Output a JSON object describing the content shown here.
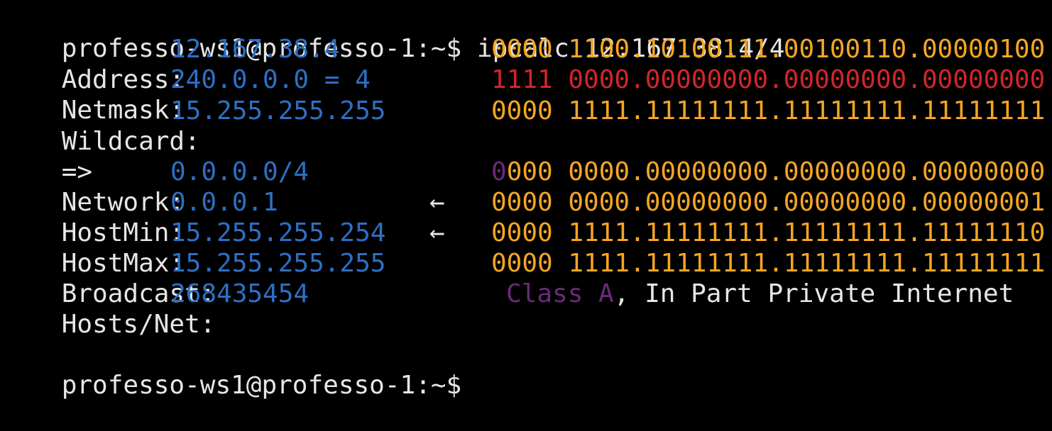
{
  "colors": {
    "background": "#000000",
    "text": "#e6e6e6",
    "value": "#2d6fc4",
    "binary": "#f5a623",
    "netmask_binary": "#d0262a",
    "class_marker": "#6b2a7a"
  },
  "prompt": "professo-ws1@professo-1:~$",
  "command": " ipcalc 12.167.38.4/4",
  "rows": {
    "address": {
      "label": "Address:",
      "value": "12.167.38.4",
      "bin_net": "0000",
      "bin_host": " 1100.10100111.00100110.00000100"
    },
    "netmask": {
      "label": "Netmask:",
      "value": "240.0.0.0 = 4",
      "bin_net": "1111",
      "bin_host": " 0000.00000000.00000000.00000000"
    },
    "wildcard": {
      "label": "Wildcard:",
      "value": "15.255.255.255",
      "bin_net": "0000",
      "bin_host": " 1111.11111111.11111111.11111111"
    },
    "network": {
      "label": "Network:",
      "value": "0.0.0.0/4",
      "bin_class": "0",
      "bin_rest": "000 0000.00000000.00000000.00000000"
    },
    "hostmin": {
      "label": "HostMin:",
      "value": "0.0.0.1",
      "arrow": "←",
      "bin": "0000 0000.00000000.00000000.00000001"
    },
    "hostmax": {
      "label": "HostMax:",
      "value": "15.255.255.254",
      "arrow": "←",
      "bin": "0000 1111.11111111.11111111.11111110"
    },
    "broadcast": {
      "label": "Broadcast:",
      "value": "15.255.255.255",
      "bin": "0000 1111.11111111.11111111.11111111"
    },
    "hosts": {
      "label": "Hosts/Net:",
      "value": "268435454",
      "class": "Class A",
      "note": ", In Part Private Internet"
    }
  },
  "arrow_line": "=>"
}
